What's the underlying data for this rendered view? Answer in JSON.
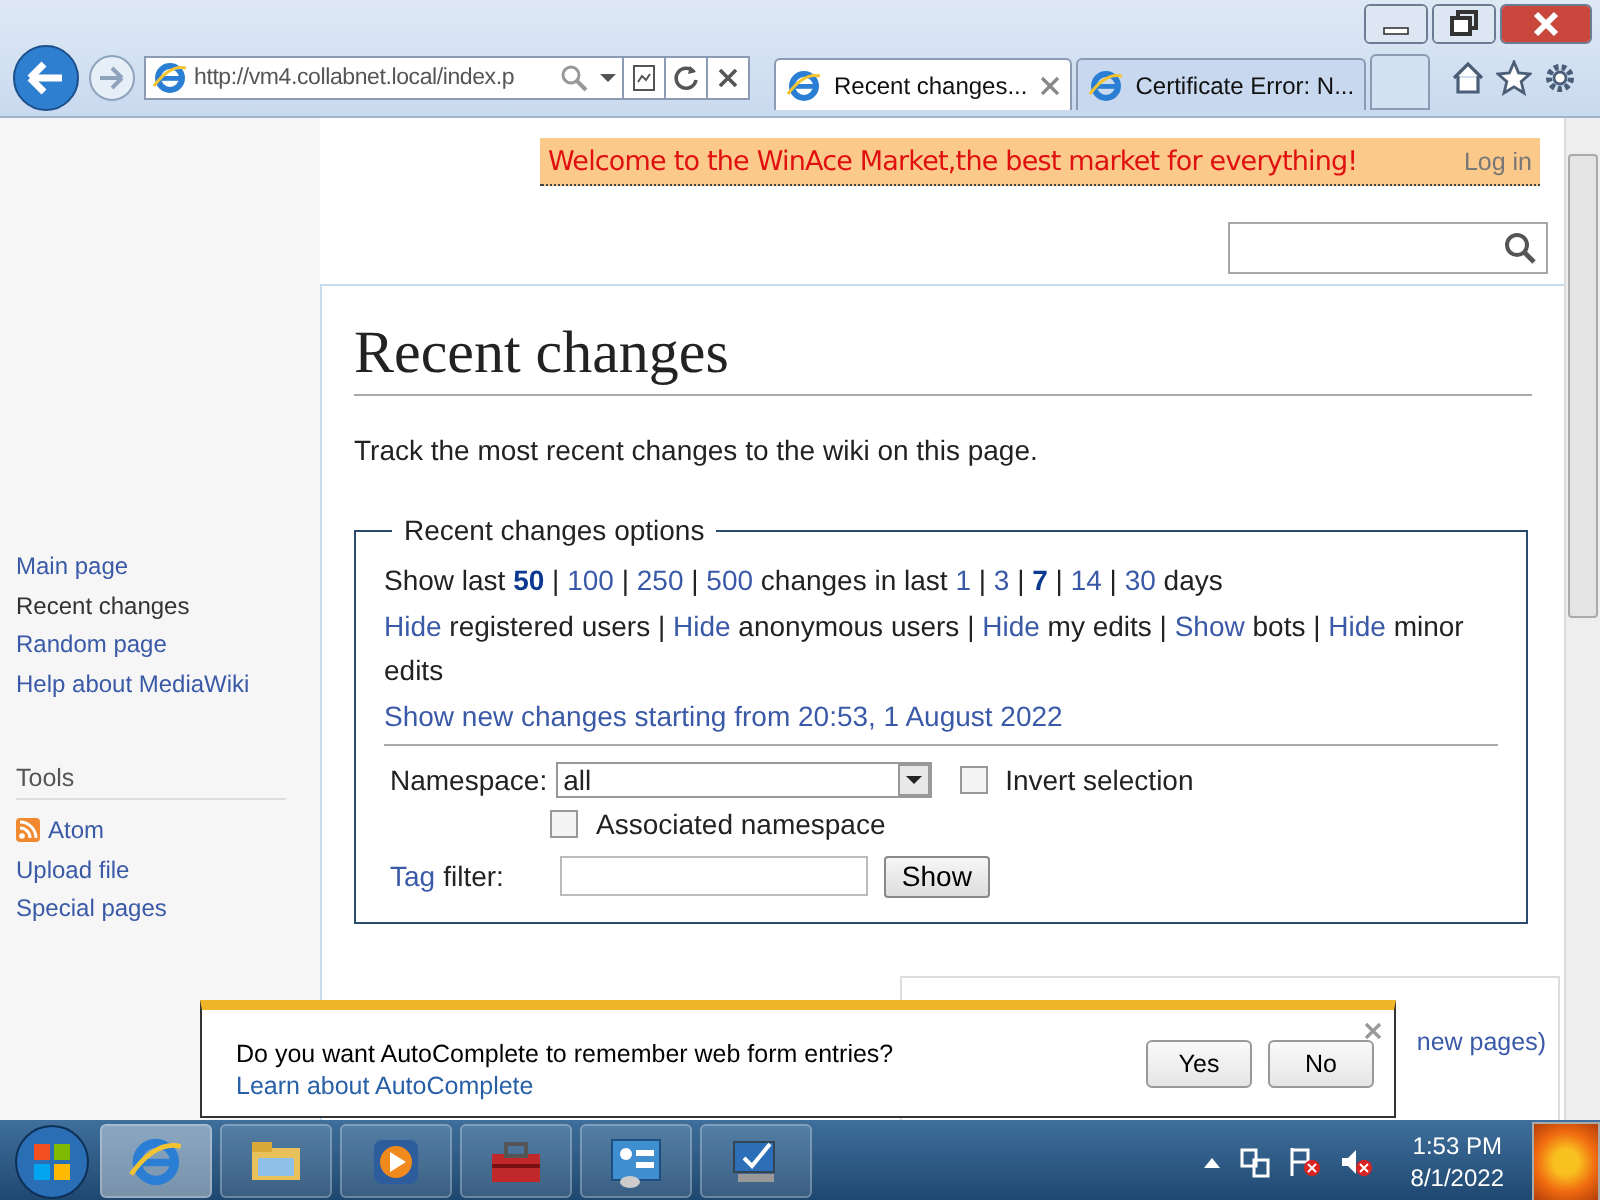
{
  "browser": {
    "address": "http://vm4.collabnet.local/index.p",
    "tabs": [
      {
        "label": "Recent changes...",
        "selected": true
      },
      {
        "label": "Certificate Error: N...",
        "selected": false
      }
    ]
  },
  "banner": {
    "text": "Welcome to the WinAce Market,the best market for everything!",
    "login": "Log in"
  },
  "sidebar": {
    "navigation": [
      {
        "label": "Main page",
        "selected": false
      },
      {
        "label": "Recent changes",
        "selected": true
      },
      {
        "label": "Random page",
        "selected": false
      },
      {
        "label": "Help about MediaWiki",
        "selected": false
      }
    ],
    "tools_heading": "Tools",
    "tools": [
      {
        "label": "Atom",
        "kind": "feed"
      },
      {
        "label": "Upload file",
        "kind": "plain"
      },
      {
        "label": "Special pages",
        "kind": "plain"
      }
    ]
  },
  "content": {
    "title": "Recent changes",
    "intro": "Track the most recent changes to the wiki on this page.",
    "options": {
      "legend": "Recent changes options",
      "lines": [
        [
          {
            "kind": "text",
            "text": "Show last "
          },
          {
            "kind": "current",
            "text": "50"
          },
          {
            "kind": "text",
            "text": " | "
          },
          {
            "kind": "link",
            "text": "100"
          },
          {
            "kind": "text",
            "text": " | "
          },
          {
            "kind": "link",
            "text": "250"
          },
          {
            "kind": "text",
            "text": " | "
          },
          {
            "kind": "link",
            "text": "500"
          },
          {
            "kind": "text",
            "text": " changes in last "
          },
          {
            "kind": "link",
            "text": "1"
          },
          {
            "kind": "text",
            "text": " | "
          },
          {
            "kind": "link",
            "text": "3"
          },
          {
            "kind": "text",
            "text": " | "
          },
          {
            "kind": "current",
            "text": "7"
          },
          {
            "kind": "text",
            "text": " | "
          },
          {
            "kind": "link",
            "text": "14"
          },
          {
            "kind": "text",
            "text": " | "
          },
          {
            "kind": "link",
            "text": "30"
          },
          {
            "kind": "text",
            "text": " days"
          }
        ],
        [
          {
            "kind": "link",
            "text": "Hide"
          },
          {
            "kind": "text",
            "text": " registered users | "
          },
          {
            "kind": "link",
            "text": "Hide"
          },
          {
            "kind": "text",
            "text": " anonymous users | "
          },
          {
            "kind": "link",
            "text": "Hide"
          },
          {
            "kind": "text",
            "text": " my edits | "
          },
          {
            "kind": "link",
            "text": "Show"
          },
          {
            "kind": "text",
            "text": " bots | "
          },
          {
            "kind": "link",
            "text": "Hide"
          },
          {
            "kind": "text",
            "text": " minor edits"
          }
        ],
        [
          {
            "kind": "link",
            "text": "Show new changes starting from 20:53, 1 August 2022"
          }
        ]
      ],
      "namespace_label": "Namespace:",
      "namespace_value": "all",
      "invert": {
        "label": "Invert selection",
        "checked": false
      },
      "associated": {
        "label": "Associated namespace",
        "checked": false
      },
      "tag_link": "Tag",
      "tag_rest": "filter:",
      "show_button": "Show"
    },
    "partial_text": "new pages)"
  },
  "autocomplete": {
    "question": "Do you want AutoComplete to remember web form entries?",
    "link": "Learn about AutoComplete",
    "buttons": [
      "Yes",
      "No"
    ]
  },
  "taskbar": {
    "apps": [
      {
        "kind": "ie",
        "active": true
      },
      {
        "kind": "folder",
        "active": false
      },
      {
        "kind": "media",
        "active": false
      },
      {
        "kind": "toolbox",
        "active": false
      },
      {
        "kind": "panel",
        "active": false
      },
      {
        "kind": "monitor",
        "active": false
      }
    ],
    "time": "1:53 PM",
    "date": "8/1/2022"
  }
}
